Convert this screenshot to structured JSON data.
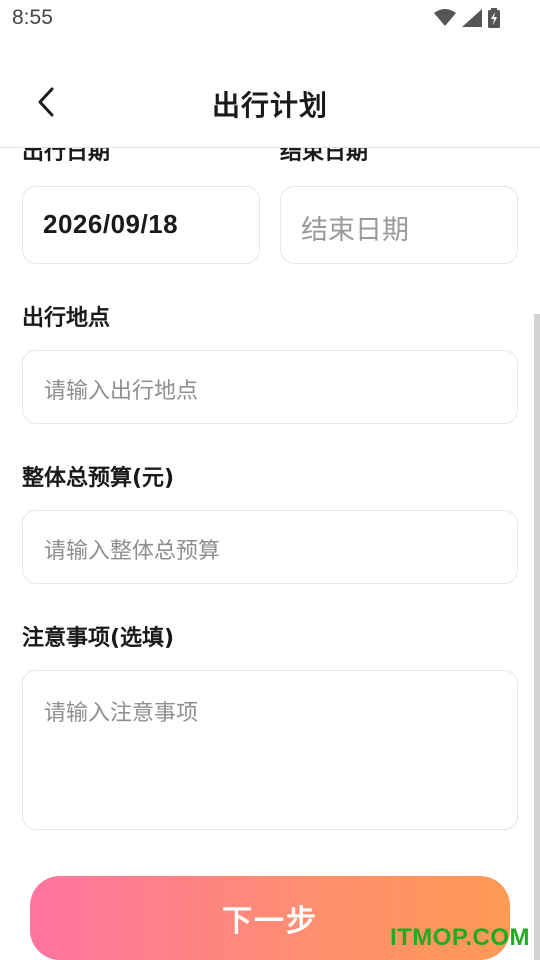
{
  "status_bar": {
    "time": "8:55",
    "icons": [
      "wifi-icon",
      "signal-icon",
      "battery-charging-icon"
    ]
  },
  "header": {
    "title": "出行计划",
    "back_icon": "chevron-left-icon"
  },
  "form": {
    "start_date_label": "出行日期",
    "start_date_value": "2026/09/18",
    "end_date_label": "结束日期",
    "end_date_placeholder": "结束日期",
    "location_label": "出行地点",
    "location_placeholder": "请输入出行地点",
    "budget_label": "整体总预算(元)",
    "budget_placeholder": "请输入整体总预算",
    "notes_label": "注意事项(选填)",
    "notes_placeholder": "请输入注意事项"
  },
  "footer": {
    "next_label": "下一步"
  },
  "watermark": "ITMOP.COM",
  "colors": {
    "button_gradient_start": "#ff74a1",
    "button_gradient_end": "#ff9a55",
    "watermark": "#22aa22",
    "placeholder": "#8f8f8f"
  }
}
